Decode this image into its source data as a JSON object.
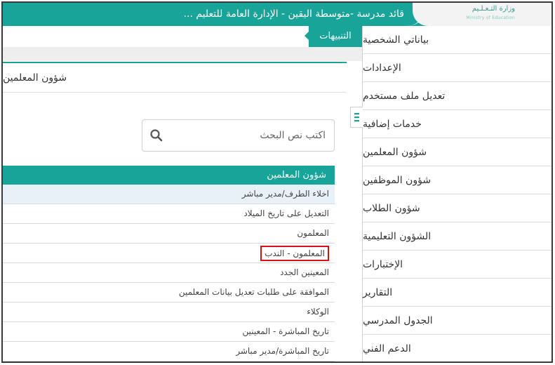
{
  "header": {
    "title": "قائد مدرسة -متوسطة اليقين - الإدارة العامة للتعليم ...",
    "logo_text": "وزارة التـعـلـيم",
    "logo_sub": "Ministry of Education",
    "accent_color": "#18a498"
  },
  "notifications": {
    "label": "التنبيهات"
  },
  "sidebar": {
    "items": [
      {
        "label": "بياناتي الشخصية"
      },
      {
        "label": "الإعدادات"
      },
      {
        "label": "تعديل ملف مستخدم"
      },
      {
        "label": "خدمات إضافية"
      },
      {
        "label": "شؤون المعلمين"
      },
      {
        "label": "شؤون الموظفين"
      },
      {
        "label": "شؤون الطلاب"
      },
      {
        "label": "الشؤون التعليمية"
      },
      {
        "label": "الإختبارات"
      },
      {
        "label": "التقارير"
      },
      {
        "label": "الجدول المدرسي"
      },
      {
        "label": "الدعم الفني"
      }
    ],
    "toggle_icon": "hamburger-icon"
  },
  "main": {
    "panel_title": "شؤون المعلمين",
    "search": {
      "placeholder": "اكتب نص البحث",
      "icon": "search-icon"
    },
    "list_header": "شؤون المعلمين",
    "list_items": [
      {
        "label": "اخلاء الطرف/مدير مباشر"
      },
      {
        "label": "التعديل على تاريخ الميلاد"
      },
      {
        "label": "المعلمون"
      },
      {
        "label": "المعلمون - الندب"
      },
      {
        "label": "المعينين الجدد"
      },
      {
        "label": "الموافقة على طلبات تعديل بيانات المعلمين"
      },
      {
        "label": "الوكلاء"
      },
      {
        "label": "تاريخ المباشرة - المعينين"
      },
      {
        "label": "تاريخ المباشرة/مدير مباشر"
      }
    ],
    "highlight_color": "#d8101a"
  }
}
